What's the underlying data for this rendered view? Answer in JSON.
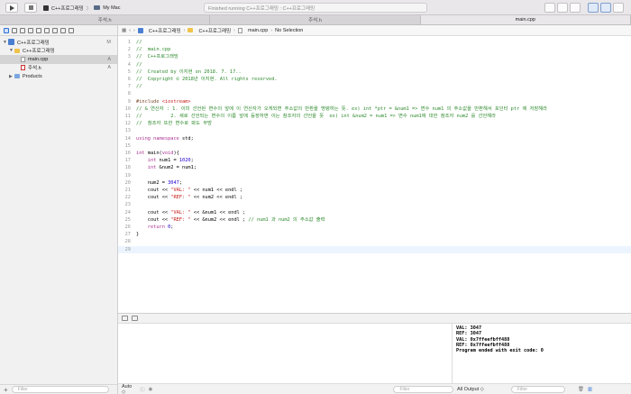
{
  "toolbar": {
    "scheme_name": "C++프로그래밍",
    "scheme_sep": "〉",
    "destination": "My Mac",
    "status": "Finished running C++프로그래밍 : C++프로그래밍"
  },
  "tabs": [
    {
      "label": "주석.h",
      "active": false
    },
    {
      "label": "주석.h",
      "active": false
    },
    {
      "label": "main.cpp",
      "active": true
    }
  ],
  "navigator": {
    "items": [
      {
        "label": "C++프로그래밍",
        "badge": "M",
        "kind": "project",
        "indent": 0,
        "tri": "▼"
      },
      {
        "label": "C++프로그래밍",
        "badge": "",
        "kind": "folder",
        "indent": 1,
        "tri": "▼"
      },
      {
        "label": "main.cpp",
        "badge": "A",
        "kind": "file",
        "indent": 2,
        "tri": "",
        "selected": true
      },
      {
        "label": "주석.h",
        "badge": "A",
        "kind": "header",
        "indent": 2,
        "tri": ""
      },
      {
        "label": "Products",
        "badge": "",
        "kind": "folder-blue",
        "indent": 1,
        "tri": "▶"
      }
    ],
    "filter_placeholder": "Filter"
  },
  "jumpbar": {
    "project": "C++프로그래밍",
    "folder": "C++프로그래밍",
    "file": "main.cpp",
    "symbol": "No Selection"
  },
  "code_lines": [
    [
      [
        "c-com",
        "//"
      ]
    ],
    [
      [
        "c-com",
        "//  main.cpp"
      ]
    ],
    [
      [
        "c-com",
        "//  C++프로그래밍"
      ]
    ],
    [
      [
        "c-com",
        "//"
      ]
    ],
    [
      [
        "c-com",
        "//  Created by 이지현 on 2018. 7. 17.."
      ]
    ],
    [
      [
        "c-com",
        "//  Copyright © 2018년 이지현. All rights reserved."
      ]
    ],
    [
      [
        "c-com",
        "//"
      ]
    ],
    [
      [
        "c-txt",
        ""
      ]
    ],
    [
      [
        "c-pp",
        "#include "
      ],
      [
        "c-str",
        "<iostream>"
      ]
    ],
    [
      [
        "c-com",
        "// & 연산자 : 1. 이미 선언된 변수의 앞에 이 연산자가 오게되면 주소값의 반환을 명령하는 뜻. ex) int *ptr = &num1 => 변수 num1 의 주소값을 반환해서 포인터 ptr 에 저장해라"
      ]
    ],
    [
      [
        "c-com",
        "//          2. 새로 선언되는 변수의 이름 앞에 등장하면 이는 참조자의 선언을 뜻  ex) int &num2 = num1 => 변수 num1에 대한 참조자 num2 를 선언해라"
      ]
    ],
    [
      [
        "c-com",
        "//  참조자 또한 변수로 봐도 무방"
      ]
    ],
    [
      [
        "c-txt",
        ""
      ]
    ],
    [
      [
        "c-kw",
        "using namespace "
      ],
      [
        "c-txt",
        "std;"
      ]
    ],
    [
      [
        "c-txt",
        ""
      ]
    ],
    [
      [
        "c-kw",
        "int "
      ],
      [
        "c-txt",
        "main("
      ],
      [
        "c-kw",
        "void"
      ],
      [
        "c-txt",
        "){"
      ]
    ],
    [
      [
        "c-txt",
        "    "
      ],
      [
        "c-kw",
        "int "
      ],
      [
        "c-txt",
        "num1 = "
      ],
      [
        "c-num",
        "1020"
      ],
      [
        "c-txt",
        ";"
      ]
    ],
    [
      [
        "c-txt",
        "    "
      ],
      [
        "c-kw",
        "int "
      ],
      [
        "c-txt",
        "&num2 = num1;"
      ]
    ],
    [
      [
        "c-txt",
        ""
      ]
    ],
    [
      [
        "c-txt",
        "    num2 = "
      ],
      [
        "c-num",
        "3047"
      ],
      [
        "c-txt",
        ";"
      ]
    ],
    [
      [
        "c-txt",
        "    cout << "
      ],
      [
        "c-str",
        "\"VAL: \""
      ],
      [
        "c-txt",
        " << num1 << endl ;"
      ]
    ],
    [
      [
        "c-txt",
        "    cout << "
      ],
      [
        "c-str",
        "\"REF: \""
      ],
      [
        "c-txt",
        " << num2 << endl ;"
      ]
    ],
    [
      [
        "c-txt",
        ""
      ]
    ],
    [
      [
        "c-txt",
        "    cout << "
      ],
      [
        "c-str",
        "\"VAL: \""
      ],
      [
        "c-txt",
        " << &num1 << endl ;"
      ]
    ],
    [
      [
        "c-txt",
        "    cout << "
      ],
      [
        "c-str",
        "\"REF: \""
      ],
      [
        "c-txt",
        " << &num2 << endl ; "
      ],
      [
        "c-com",
        "// num1 과 num2 의 주소값 출력"
      ]
    ],
    [
      [
        "c-txt",
        "    "
      ],
      [
        "c-kw",
        "return "
      ],
      [
        "c-num",
        "0"
      ],
      [
        "c-txt",
        ";"
      ]
    ],
    [
      [
        "c-txt",
        "}"
      ]
    ],
    [
      [
        "c-txt",
        ""
      ]
    ],
    [
      [
        "c-txt",
        ""
      ]
    ]
  ],
  "console_lines": [
    "VAL: 3047",
    "REF: 3047",
    "VAL: 0x7ffeefbff488",
    "REF: 0x7ffeefbff488",
    "Program ended with exit code: 0"
  ],
  "debug": {
    "auto_label": "Auto ◇",
    "filter_placeholder": "Filter",
    "output_label": "All Output ◇",
    "output_filter_placeholder": "Filter"
  }
}
